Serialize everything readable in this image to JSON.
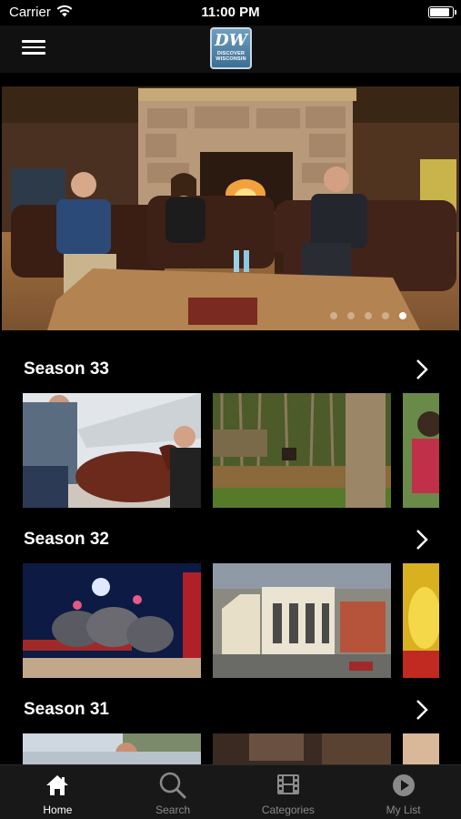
{
  "status": {
    "carrier": "Carrier",
    "time": "11:00 PM"
  },
  "header": {
    "logo_mark": "DW",
    "logo_text_line1": "DISCOVER",
    "logo_text_line2": "WISCONSIN"
  },
  "hero": {
    "slide_count": 5,
    "active_slide": 5
  },
  "sections": [
    {
      "title": "Season 33"
    },
    {
      "title": "Season 32"
    },
    {
      "title": "Season 31"
    }
  ],
  "tabs": [
    {
      "label": "Home",
      "icon": "home-icon",
      "active": true
    },
    {
      "label": "Search",
      "icon": "search-icon",
      "active": false
    },
    {
      "label": "Categories",
      "icon": "film-icon",
      "active": false
    },
    {
      "label": "My List",
      "icon": "play-circle-icon",
      "active": false
    }
  ],
  "colors": {
    "background": "#000000",
    "tab_bar": "#181818",
    "nav_bar": "#111111",
    "inactive_tab": "#8a8a8a"
  }
}
